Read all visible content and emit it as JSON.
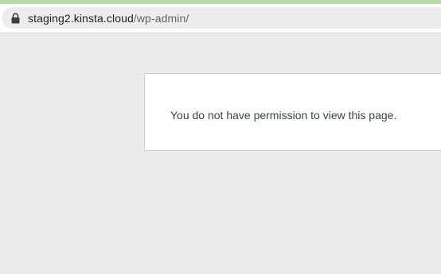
{
  "browser": {
    "url_host": "staging2.kinsta.cloud",
    "url_path": "/wp-admin/",
    "lock_icon": "lock-icon"
  },
  "colors": {
    "accent_bar": "#b6dea5",
    "page_background": "#ebebeb",
    "box_background": "#ffffff"
  },
  "message": {
    "text": "You do not have permission to view this page."
  }
}
